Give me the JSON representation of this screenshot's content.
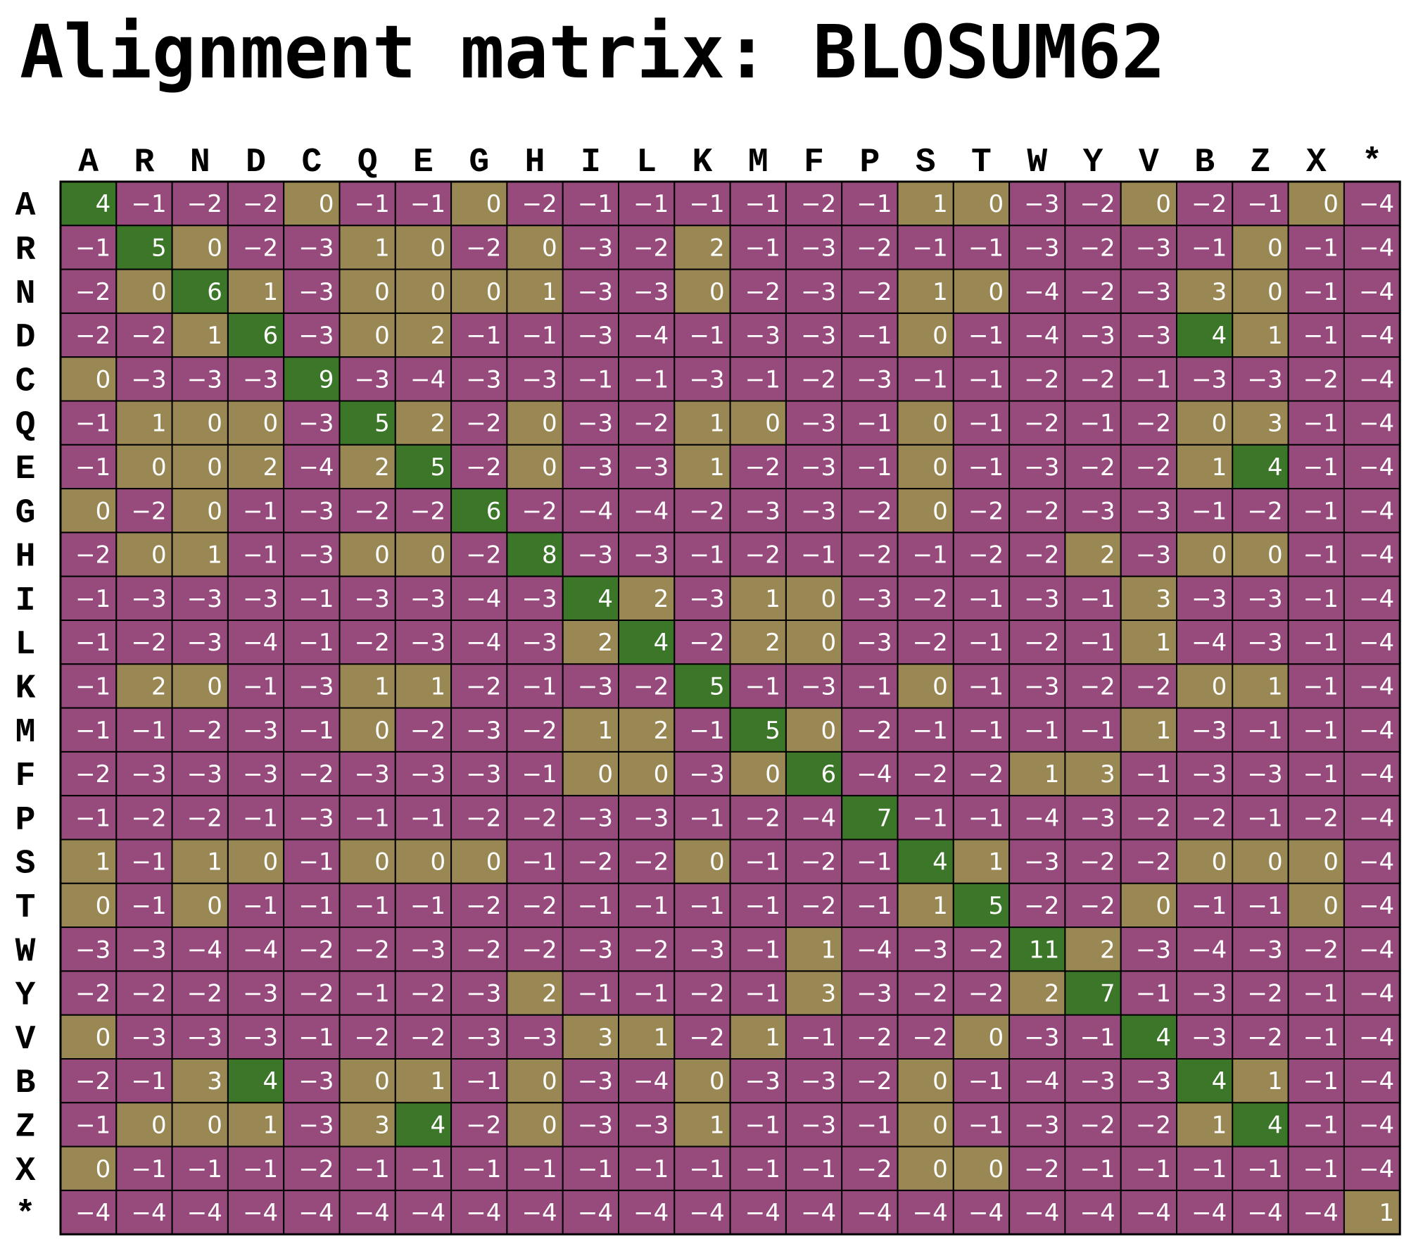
{
  "title": "Alignment matrix: BLOSUM62",
  "chart_data": {
    "type": "heatmap",
    "title": "Alignment matrix: BLOSUM62",
    "columns": [
      "A",
      "R",
      "N",
      "D",
      "C",
      "Q",
      "E",
      "G",
      "H",
      "I",
      "L",
      "K",
      "M",
      "F",
      "P",
      "S",
      "T",
      "W",
      "Y",
      "V",
      "B",
      "Z",
      "X",
      "*"
    ],
    "rows": [
      "A",
      "R",
      "N",
      "D",
      "C",
      "Q",
      "E",
      "G",
      "H",
      "I",
      "L",
      "K",
      "M",
      "F",
      "P",
      "S",
      "T",
      "W",
      "Y",
      "V",
      "B",
      "Z",
      "X",
      "*"
    ],
    "values": [
      [
        4,
        -1,
        -2,
        -2,
        0,
        -1,
        -1,
        0,
        -2,
        -1,
        -1,
        -1,
        -1,
        -2,
        -1,
        1,
        0,
        -3,
        -2,
        0,
        -2,
        -1,
        0,
        -4
      ],
      [
        -1,
        5,
        0,
        -2,
        -3,
        1,
        0,
        -2,
        0,
        -3,
        -2,
        2,
        -1,
        -3,
        -2,
        -1,
        -1,
        -3,
        -2,
        -3,
        -1,
        0,
        -1,
        -4
      ],
      [
        -2,
        0,
        6,
        1,
        -3,
        0,
        0,
        0,
        1,
        -3,
        -3,
        0,
        -2,
        -3,
        -2,
        1,
        0,
        -4,
        -2,
        -3,
        3,
        0,
        -1,
        -4
      ],
      [
        -2,
        -2,
        1,
        6,
        -3,
        0,
        2,
        -1,
        -1,
        -3,
        -4,
        -1,
        -3,
        -3,
        -1,
        0,
        -1,
        -4,
        -3,
        -3,
        4,
        1,
        -1,
        -4
      ],
      [
        0,
        -3,
        -3,
        -3,
        9,
        -3,
        -4,
        -3,
        -3,
        -1,
        -1,
        -3,
        -1,
        -2,
        -3,
        -1,
        -1,
        -2,
        -2,
        -1,
        -3,
        -3,
        -2,
        -4
      ],
      [
        -1,
        1,
        0,
        0,
        -3,
        5,
        2,
        -2,
        0,
        -3,
        -2,
        1,
        0,
        -3,
        -1,
        0,
        -1,
        -2,
        -1,
        -2,
        0,
        3,
        -1,
        -4
      ],
      [
        -1,
        0,
        0,
        2,
        -4,
        2,
        5,
        -2,
        0,
        -3,
        -3,
        1,
        -2,
        -3,
        -1,
        0,
        -1,
        -3,
        -2,
        -2,
        1,
        4,
        -1,
        -4
      ],
      [
        0,
        -2,
        0,
        -1,
        -3,
        -2,
        -2,
        6,
        -2,
        -4,
        -4,
        -2,
        -3,
        -3,
        -2,
        0,
        -2,
        -2,
        -3,
        -3,
        -1,
        -2,
        -1,
        -4
      ],
      [
        -2,
        0,
        1,
        -1,
        -3,
        0,
        0,
        -2,
        8,
        -3,
        -3,
        -1,
        -2,
        -1,
        -2,
        -1,
        -2,
        -2,
        2,
        -3,
        0,
        0,
        -1,
        -4
      ],
      [
        -1,
        -3,
        -3,
        -3,
        -1,
        -3,
        -3,
        -4,
        -3,
        4,
        2,
        -3,
        1,
        0,
        -3,
        -2,
        -1,
        -3,
        -1,
        3,
        -3,
        -3,
        -1,
        -4
      ],
      [
        -1,
        -2,
        -3,
        -4,
        -1,
        -2,
        -3,
        -4,
        -3,
        2,
        4,
        -2,
        2,
        0,
        -3,
        -2,
        -1,
        -2,
        -1,
        1,
        -4,
        -3,
        -1,
        -4
      ],
      [
        -1,
        2,
        0,
        -1,
        -3,
        1,
        1,
        -2,
        -1,
        -3,
        -2,
        5,
        -1,
        -3,
        -1,
        0,
        -1,
        -3,
        -2,
        -2,
        0,
        1,
        -1,
        -4
      ],
      [
        -1,
        -1,
        -2,
        -3,
        -1,
        0,
        -2,
        -3,
        -2,
        1,
        2,
        -1,
        5,
        0,
        -2,
        -1,
        -1,
        -1,
        -1,
        1,
        -3,
        -1,
        -1,
        -4
      ],
      [
        -2,
        -3,
        -3,
        -3,
        -2,
        -3,
        -3,
        -3,
        -1,
        0,
        0,
        -3,
        0,
        6,
        -4,
        -2,
        -2,
        1,
        3,
        -1,
        -3,
        -3,
        -1,
        -4
      ],
      [
        -1,
        -2,
        -2,
        -1,
        -3,
        -1,
        -1,
        -2,
        -2,
        -3,
        -3,
        -1,
        -2,
        -4,
        7,
        -1,
        -1,
        -4,
        -3,
        -2,
        -2,
        -1,
        -2,
        -4
      ],
      [
        1,
        -1,
        1,
        0,
        -1,
        0,
        0,
        0,
        -1,
        -2,
        -2,
        0,
        -1,
        -2,
        -1,
        4,
        1,
        -3,
        -2,
        -2,
        0,
        0,
        0,
        -4
      ],
      [
        0,
        -1,
        0,
        -1,
        -1,
        -1,
        -1,
        -2,
        -2,
        -1,
        -1,
        -1,
        -1,
        -2,
        -1,
        1,
        5,
        -2,
        -2,
        0,
        -1,
        -1,
        0,
        -4
      ],
      [
        -3,
        -3,
        -4,
        -4,
        -2,
        -2,
        -3,
        -2,
        -2,
        -3,
        -2,
        -3,
        -1,
        1,
        -4,
        -3,
        -2,
        11,
        2,
        -3,
        -4,
        -3,
        -2,
        -4
      ],
      [
        -2,
        -2,
        -2,
        -3,
        -2,
        -1,
        -2,
        -3,
        2,
        -1,
        -1,
        -2,
        -1,
        3,
        -3,
        -2,
        -2,
        2,
        7,
        -1,
        -3,
        -2,
        -1,
        -4
      ],
      [
        0,
        -3,
        -3,
        -3,
        -1,
        -2,
        -2,
        -3,
        -3,
        3,
        1,
        -2,
        1,
        -1,
        -2,
        -2,
        0,
        -3,
        -1,
        4,
        -3,
        -2,
        -1,
        -4
      ],
      [
        -2,
        -1,
        3,
        4,
        -3,
        0,
        1,
        -1,
        0,
        -3,
        -4,
        0,
        -3,
        -3,
        -2,
        0,
        -1,
        -4,
        -3,
        -3,
        4,
        1,
        -1,
        -4
      ],
      [
        -1,
        0,
        0,
        1,
        -3,
        3,
        4,
        -2,
        0,
        -3,
        -3,
        1,
        -1,
        -3,
        -1,
        0,
        -1,
        -3,
        -2,
        -2,
        1,
        4,
        -1,
        -4
      ],
      [
        0,
        -1,
        -1,
        -1,
        -2,
        -1,
        -1,
        -1,
        -1,
        -1,
        -1,
        -1,
        -1,
        -1,
        -2,
        0,
        0,
        -2,
        -1,
        -1,
        -1,
        -1,
        -1,
        -4
      ],
      [
        -4,
        -4,
        -4,
        -4,
        -4,
        -4,
        -4,
        -4,
        -4,
        -4,
        -4,
        -4,
        -4,
        -4,
        -4,
        -4,
        -4,
        -4,
        -4,
        -4,
        -4,
        -4,
        -4,
        1
      ]
    ],
    "highlight": [
      [
        0,
        0
      ],
      [
        1,
        1
      ],
      [
        2,
        2
      ],
      [
        3,
        3
      ],
      [
        4,
        4
      ],
      [
        5,
        5
      ],
      [
        6,
        6
      ],
      [
        7,
        7
      ],
      [
        8,
        8
      ],
      [
        9,
        9
      ],
      [
        10,
        10
      ],
      [
        11,
        11
      ],
      [
        12,
        12
      ],
      [
        13,
        13
      ],
      [
        14,
        14
      ],
      [
        15,
        15
      ],
      [
        16,
        16
      ],
      [
        17,
        17
      ],
      [
        18,
        18
      ],
      [
        19,
        19
      ],
      [
        20,
        3
      ],
      [
        20,
        20
      ],
      [
        21,
        6
      ],
      [
        21,
        21
      ],
      [
        3,
        20
      ],
      [
        6,
        21
      ]
    ],
    "colors": {
      "negative": "#974b7d",
      "non_negative": "#9a8854",
      "match": "#3b7629",
      "grid": "#000000",
      "text": "#ffffff"
    }
  }
}
